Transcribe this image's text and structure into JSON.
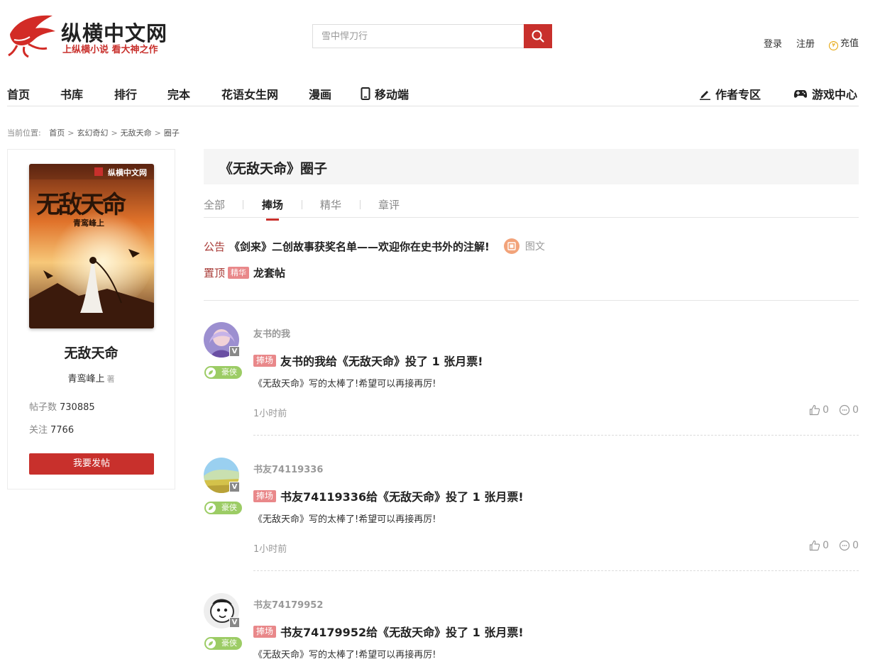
{
  "header": {
    "logo_title": "纵横中文网",
    "logo_slogan": "上纵横小说  看大神之作",
    "search_placeholder": "雪中悍刀行",
    "links": {
      "login": "登录",
      "register": "注册",
      "recharge": "充值"
    }
  },
  "nav": {
    "items": [
      "首页",
      "书库",
      "排行",
      "完本",
      "花语女生网",
      "漫画",
      "移动端"
    ],
    "right": [
      "作者专区",
      "游戏中心"
    ]
  },
  "breadcrumb": {
    "prefix": "当前位置:",
    "items": [
      "首页",
      "玄幻奇幻",
      "无敌天命",
      "圈子"
    ],
    "sep": ">"
  },
  "book": {
    "cover_brand": "纵横中文网",
    "cover_title": "无敌天命",
    "cover_author": "青鸾峰上",
    "name": "无敌天命",
    "author": "青鸾峰上",
    "author_suffix": "著",
    "posts_label": "帖子数",
    "posts": "730885",
    "follow_label": "关注",
    "follow": "7766",
    "post_button": "我要发帖"
  },
  "circle": {
    "title": "《无敌天命》圈子",
    "tabs": [
      "全部",
      "捧场",
      "精华",
      "章评"
    ],
    "active_tab": 1,
    "notice": {
      "tag": "公告",
      "text": "《剑来》二创故事获奖名单——欢迎你在史书外的注解!",
      "extra": "图文"
    },
    "pinned": {
      "tag": "置顶",
      "badge": "精华",
      "text": "龙套帖"
    }
  },
  "posts": [
    {
      "user": "友书的我",
      "badge": "捧场",
      "title": "友书的我给《无敌天命》投了 1 张月票!",
      "body": "《无敌天命》写的太棒了!希望可以再接再厉!",
      "time": "1小时前",
      "likes": "0",
      "comments": "0",
      "level": "豪侠",
      "v": "V"
    },
    {
      "user": "书友74119336",
      "badge": "捧场",
      "title": "书友74119336给《无敌天命》投了 1 张月票!",
      "body": "《无敌天命》写的太棒了!希望可以再接再厉!",
      "time": "1小时前",
      "likes": "0",
      "comments": "0",
      "level": "豪侠",
      "v": "V"
    },
    {
      "user": "书友74179952",
      "badge": "捧场",
      "title": "书友74179952给《无敌天命》投了 1 张月票!",
      "body": "《无敌天命》写的太棒了!希望可以再接再厉!",
      "level": "豪侠",
      "v": "V"
    }
  ],
  "colors": {
    "accent": "#c8302c",
    "badge": "#e9888a",
    "level": "#9ccc65"
  }
}
